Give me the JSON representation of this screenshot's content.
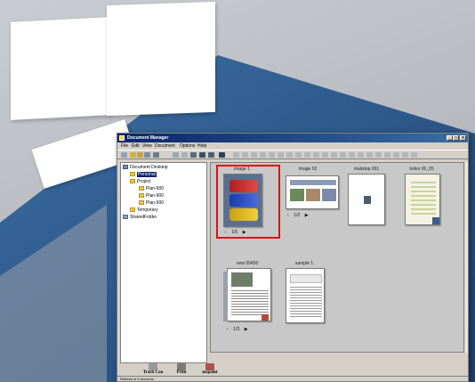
{
  "colors": {
    "title_bar_start": "#0a246a",
    "title_bar_end": "#3a6ea5",
    "wedge_blue": "#2e5a8d",
    "highlight_red": "#e01010",
    "folder_yellow": "#e7c64a"
  },
  "window": {
    "title": "Document Manager",
    "title_icon": "app-icon",
    "buttons": [
      "minimize",
      "maximize",
      "close"
    ]
  },
  "menu": {
    "items": [
      "File",
      "Edit",
      "View",
      "Document",
      "Options",
      "Help"
    ]
  },
  "tree": {
    "items": [
      {
        "label": "Document Desktop",
        "icon": "desktop-icon"
      },
      {
        "label": "Personal",
        "icon": "folder-icon"
      },
      {
        "label": "Project",
        "icon": "folder-icon"
      },
      {
        "label": "Plan-900",
        "icon": "folder-icon"
      },
      {
        "label": "Plan-900",
        "icon": "folder-icon"
      },
      {
        "label": "Plan-900",
        "icon": "folder-icon"
      },
      {
        "label": "Temporary",
        "icon": "folder-icon"
      },
      {
        "label": "SharedFolder",
        "icon": "shared-folder-icon"
      }
    ]
  },
  "thumbnails": [
    {
      "label": "image 1",
      "pager": "1/5"
    },
    {
      "label": "image 02",
      "pager": "1/2"
    },
    {
      "label": "mailstop 001",
      "pager": ""
    },
    {
      "label": "index 00_05",
      "pager": ""
    },
    {
      "label": "new 00450",
      "pager": "1/3"
    },
    {
      "label": "sample 1",
      "pager": ""
    }
  ],
  "tray": {
    "items": [
      {
        "label": "Trash Can",
        "icon": "trash-can-icon"
      },
      {
        "label": "Print",
        "icon": "printer-icon"
      },
      {
        "label": "mspaint",
        "icon": "paint-icon"
      }
    ]
  },
  "status": {
    "text": "Refresh in 0 seconds"
  }
}
